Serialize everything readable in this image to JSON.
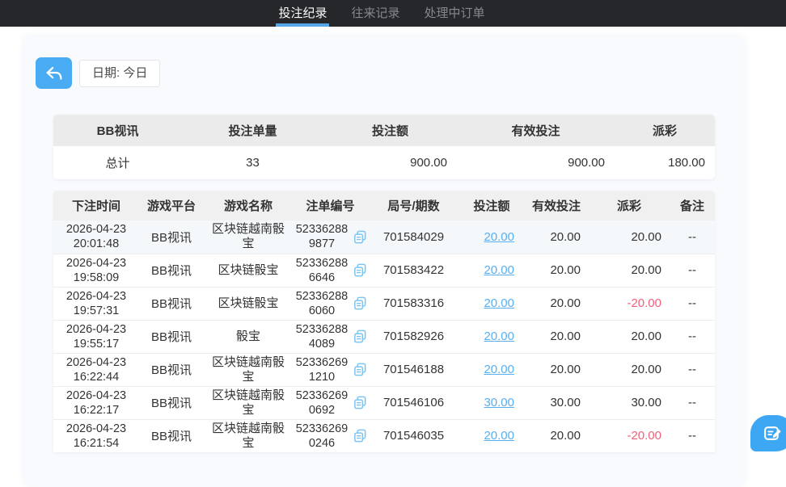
{
  "nav": {
    "tabs": [
      {
        "label": "投注纪录",
        "active": true
      },
      {
        "label": "往来记录",
        "active": false
      },
      {
        "label": "处理中订单",
        "active": false
      }
    ]
  },
  "toolbar": {
    "date_label": "日期: 今日"
  },
  "summary": {
    "columns": [
      "BB视讯",
      "投注单量",
      "投注额",
      "有效投注",
      "派彩"
    ],
    "total": {
      "label": "总计",
      "bet_count": "33",
      "bet_amount": "900.00",
      "valid_bet": "900.00",
      "payout": "180.00"
    }
  },
  "records": {
    "columns": [
      "下注时间",
      "游戏平台",
      "游戏名称",
      "注单编号",
      "局号/期数",
      "投注额",
      "有效投注",
      "派彩",
      "备注"
    ],
    "rows": [
      {
        "date": "2026-04-23",
        "time": "20:01:48",
        "platform": "BB视讯",
        "game": "区块链越南骰宝",
        "order_no": "523362889877",
        "round_no": "701584029",
        "bet_amount": "20.00",
        "valid_bet": "20.00",
        "payout": "20.00",
        "remark": "--"
      },
      {
        "date": "2026-04-23",
        "time": "19:58:09",
        "platform": "BB视讯",
        "game": "区块链骰宝",
        "order_no": "523362886646",
        "round_no": "701583422",
        "bet_amount": "20.00",
        "valid_bet": "20.00",
        "payout": "20.00",
        "remark": "--"
      },
      {
        "date": "2026-04-23",
        "time": "19:57:31",
        "platform": "BB视讯",
        "game": "区块链骰宝",
        "order_no": "523362886060",
        "round_no": "701583316",
        "bet_amount": "20.00",
        "valid_bet": "20.00",
        "payout": "-20.00",
        "remark": "--"
      },
      {
        "date": "2026-04-23",
        "time": "19:55:17",
        "platform": "BB视讯",
        "game": "骰宝",
        "order_no": "523362884089",
        "round_no": "701582926",
        "bet_amount": "20.00",
        "valid_bet": "20.00",
        "payout": "20.00",
        "remark": "--"
      },
      {
        "date": "2026-04-23",
        "time": "16:22:44",
        "platform": "BB视讯",
        "game": "区块链越南骰宝",
        "order_no": "523362691210",
        "round_no": "701546188",
        "bet_amount": "20.00",
        "valid_bet": "20.00",
        "payout": "20.00",
        "remark": "--"
      },
      {
        "date": "2026-04-23",
        "time": "16:22:17",
        "platform": "BB视讯",
        "game": "区块链越南骰宝",
        "order_no": "523362690692",
        "round_no": "701546106",
        "bet_amount": "30.00",
        "valid_bet": "30.00",
        "payout": "30.00",
        "remark": "--"
      },
      {
        "date": "2026-04-23",
        "time": "16:21:54",
        "platform": "BB视讯",
        "game": "区块链越南骰宝",
        "order_no": "523362690246",
        "round_no": "701546035",
        "bet_amount": "20.00",
        "valid_bet": "20.00",
        "payout": "-20.00",
        "remark": "--"
      }
    ]
  },
  "icons": {
    "back": "undo-arrow",
    "copy": "copy-document",
    "fab": "edit-note"
  },
  "colors": {
    "navbar_bg": "#26272a",
    "tab_active_underline": "#54a8ea",
    "accent_blue": "#49abf2",
    "link_blue": "#58aff0",
    "copy_icon_blue": "#7cc5f2",
    "negative_red": "#f0607a",
    "panel_bg": "#f8fafd",
    "summary_header_bg": "#ebebeb",
    "records_header_bg": "#f0f0f0"
  }
}
